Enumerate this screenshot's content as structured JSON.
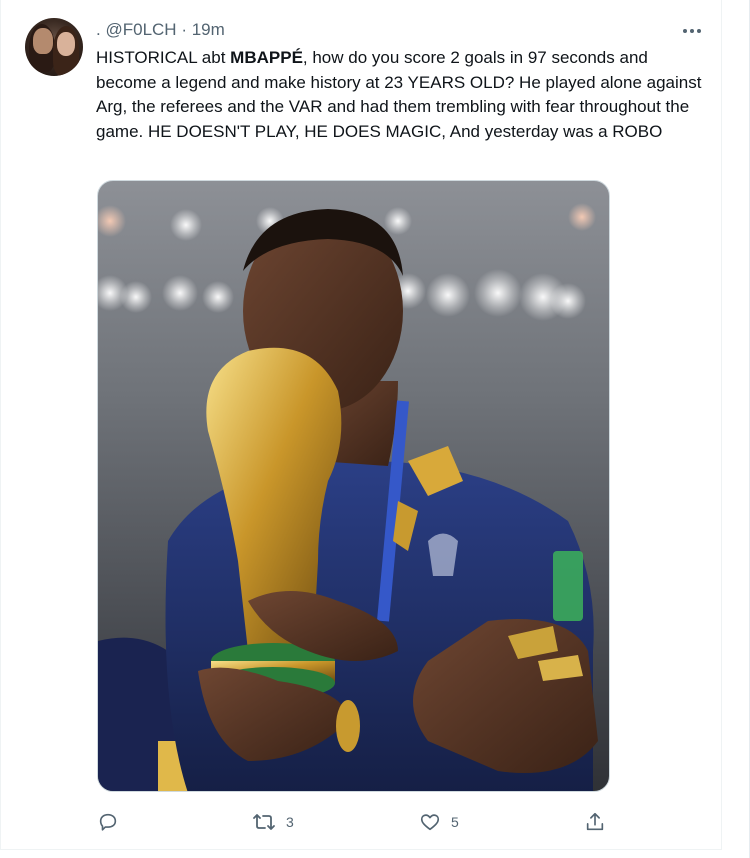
{
  "tweet": {
    "display_prefix": ".",
    "handle": "@F0LCH",
    "separator": "·",
    "time": "19m",
    "text_part1": "HISTORICAL abt ",
    "text_bold": "MBAPPÉ",
    "text_part2": ", how do you score 2 goals in 97 seconds and become a legend and make history at 23 YEARS OLD? He played alone against Arg, the referees and the VAR and had them trembling with fear throughout the game. HE DOESN'T PLAY, HE DOES MAGIC, And yesterday was a ROBO",
    "retweet_count": "3",
    "like_count": "5"
  },
  "colors": {
    "text_primary": "#0f1419",
    "text_secondary": "#536471",
    "border": "#eff3f4"
  },
  "icons": {
    "more": "more-horizontal-icon",
    "reply": "reply-icon",
    "retweet": "retweet-icon",
    "like": "heart-icon",
    "share": "share-icon"
  }
}
